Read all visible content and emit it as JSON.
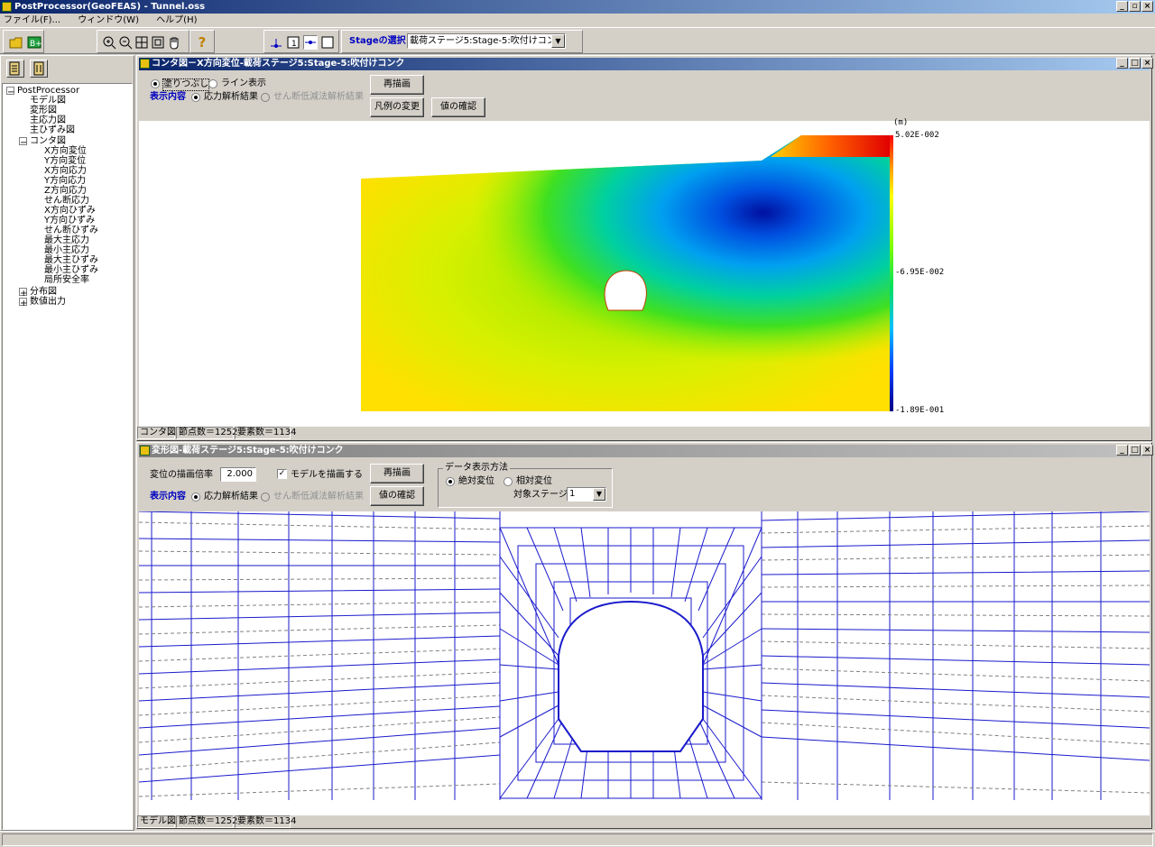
{
  "app": {
    "title": "PostProcessor(GeoFEAS) - Tunnel.oss",
    "menu": [
      "ファイル(F)...",
      "ウィンドウ(W)",
      "ヘルプ(H)"
    ],
    "caption_buttons": [
      "_",
      "▫",
      "×"
    ]
  },
  "toolbar": {
    "stage_label": "Stageの選択",
    "stage_value": "載荷ステージ5:Stage-5:吹付けコンク"
  },
  "tree": {
    "root": "PostProcessor",
    "items": [
      "モデル図",
      "変形図",
      "主応力図",
      "主ひずみ図"
    ],
    "contour_group": "コンタ図",
    "contour_items": [
      "X方向変位",
      "Y方向変位",
      "X方向応力",
      "Y方向応力",
      "Z方向応力",
      "せん断応力",
      "X方向ひずみ",
      "Y方向ひずみ",
      "せん断ひずみ",
      "最大主応力",
      "最小主応力",
      "最大主ひずみ",
      "最小主ひずみ",
      "局所安全率"
    ],
    "other_groups": [
      "分布図",
      "数値出力"
    ]
  },
  "contour_window": {
    "title": "コンタ図－X方向変位-載荷ステージ5:Stage-5:吹付けコンク",
    "fill_option": "塗りつぶし",
    "line_option": "ライン表示",
    "display_label": "表示内容",
    "stress_result": "応力解析結果",
    "shear_result": "せん断低減法解析結果",
    "redraw": "再描画",
    "legend_change": "凡例の変更",
    "value_check": "値の確認",
    "legend_unit": "(m)",
    "legend_max": "5.02E-002",
    "legend_mid": "-6.95E-002",
    "legend_min": "-1.89E-001",
    "status": [
      "コンタ図",
      "節点数＝1252",
      "要素数＝1134"
    ]
  },
  "deform_window": {
    "title": "変形図-載荷ステージ5:Stage-5:吹付けコンク",
    "scale_label": "変位の描画倍率",
    "scale_value": "2.000",
    "draw_model": "モデルを描画する",
    "display_label": "表示内容",
    "stress_result": "応力解析結果",
    "shear_result": "せん断低減法解析結果",
    "redraw": "再描画",
    "value_check": "値の確認",
    "data_group": "データ表示方法",
    "absolute": "絶対変位",
    "relative": "相対変位",
    "target_stage_label": "対象ステージ",
    "target_stage_value": "1",
    "status": [
      "モデル図",
      "節点数＝1252",
      "要素数＝1134"
    ]
  },
  "colors": {
    "title_active": "#0a246a",
    "mesh_line": "#1a1acc",
    "mesh_dash": "#808080"
  }
}
